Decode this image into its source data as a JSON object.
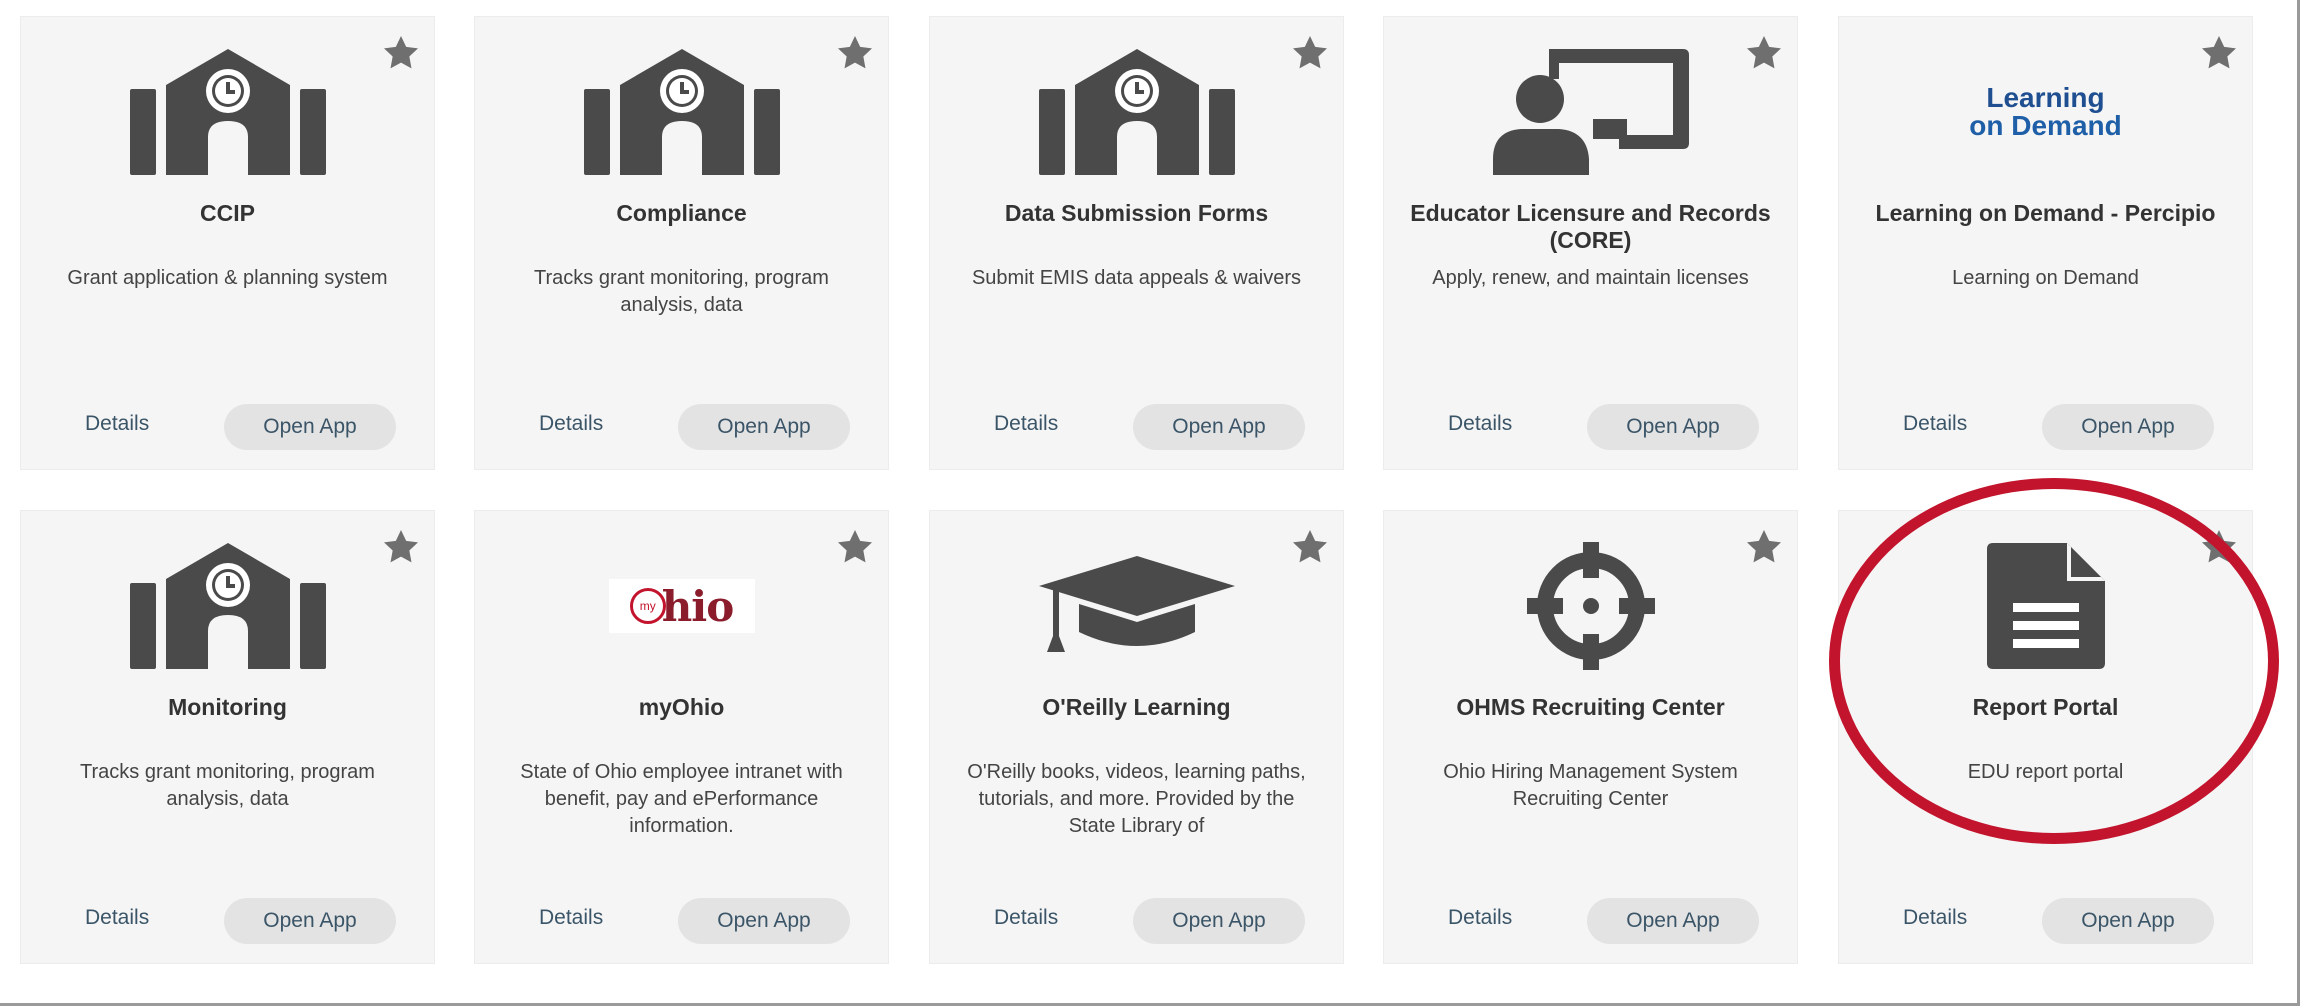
{
  "apps": [
    {
      "title": "CCIP",
      "description": "Grant application & planning system",
      "icon": "school-building-icon",
      "details_label": "Details",
      "open_label": "Open App"
    },
    {
      "title": "Compliance",
      "description": "Tracks grant monitoring, program analysis, data",
      "icon": "school-building-icon",
      "details_label": "Details",
      "open_label": "Open App"
    },
    {
      "title": "Data Submission Forms",
      "description": "Submit EMIS data appeals & waivers",
      "icon": "school-building-icon",
      "details_label": "Details",
      "open_label": "Open App"
    },
    {
      "title": "Educator Licensure and Records (CORE)",
      "description": "Apply, renew, and maintain licenses",
      "icon": "presenter-board-icon",
      "details_label": "Details",
      "open_label": "Open App"
    },
    {
      "title": "Learning on Demand - Percipio",
      "description": "Learning on Demand",
      "icon": "learning-on-demand-logo",
      "logo_line1": "Learning",
      "logo_line2": "on Demand",
      "details_label": "Details",
      "open_label": "Open App"
    },
    {
      "title": "Monitoring",
      "description": "Tracks grant monitoring, program analysis, data",
      "icon": "school-building-icon",
      "details_label": "Details",
      "open_label": "Open App"
    },
    {
      "title": "myOhio",
      "description": "State of Ohio employee intranet with benefit, pay and ePerformance information.",
      "icon": "myohio-logo",
      "logo_my": "my",
      "logo_text": "hio",
      "details_label": "Details",
      "open_label": "Open App"
    },
    {
      "title": "O'Reilly Learning",
      "description": "O'Reilly books, videos, learning paths, tutorials, and more. Provided by the State Library of",
      "icon": "graduation-cap-icon",
      "details_label": "Details",
      "open_label": "Open App"
    },
    {
      "title": "OHMS Recruiting Center",
      "description": "Ohio Hiring Management System Recruiting Center",
      "icon": "crosshairs-icon",
      "details_label": "Details",
      "open_label": "Open App"
    },
    {
      "title": "Report Portal",
      "description": "EDU report portal",
      "icon": "document-icon",
      "details_label": "Details",
      "open_label": "Open App"
    }
  ],
  "colors": {
    "card_bg": "#f5f5f5",
    "icon_gray": "#4a4a4a",
    "star_gray": "#6f6f6f",
    "link_text": "#3b5568",
    "highlight_ring": "#c3142d"
  }
}
